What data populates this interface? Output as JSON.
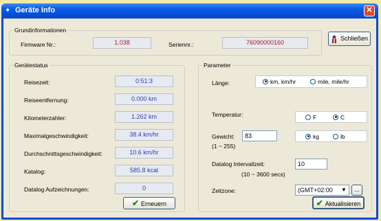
{
  "window": {
    "title": "Geräte Info"
  },
  "basic": {
    "legend": "Grundinformationen",
    "firmware_label": "Firmware Nr.:",
    "firmware_value": "1.038",
    "serial_label": "Seriennr.:",
    "serial_value": "76090000160"
  },
  "close_button": {
    "label": "Schließen",
    "icon": "person-icon"
  },
  "status": {
    "legend": "Gerätestatus",
    "rows": [
      {
        "label": "Reisezeit:",
        "value": "0:51:3"
      },
      {
        "label": "Reiseentfernung:",
        "value": "0.000 km"
      },
      {
        "label": "Kilometerzahler:",
        "value": "1.262 km"
      },
      {
        "label": "Maximalgeschwindigkeit:",
        "value": "38.4 km/hr"
      },
      {
        "label": "Durchschnittsgeschwindigkeit:",
        "value": "10.6 km/hr"
      },
      {
        "label": "Katalog:",
        "value": "585.8 kcal"
      },
      {
        "label": "Datalog Aufzeichnungen:",
        "value": "0"
      }
    ],
    "renew_label": "Erneuern"
  },
  "params": {
    "legend": "Parameter",
    "length_label": "Länge:",
    "length_options": [
      "km, km/hr",
      "mile, mile/hr"
    ],
    "length_selected": "km, km/hr",
    "temp_label": "Temperatur:",
    "temp_options": [
      "F",
      "C"
    ],
    "temp_selected": "C",
    "weight_label": "Gewicht:",
    "weight_range": "(1 ~ 255)",
    "weight_value": "83",
    "weight_units": [
      "kg",
      "lb"
    ],
    "weight_unit_selected": "kg",
    "interval_label": "Datalog Intervallzeit:",
    "interval_range": "(10 ~ 3600 secs)",
    "interval_value": "10",
    "timezone_label": "Zeitzone:",
    "timezone_value": "(GMT+02:00",
    "more_label": "...",
    "update_label": "Aktualisieren"
  },
  "colors": {
    "title_bar": "#0a5ce8",
    "dialog_bg": "#ece9d8",
    "serial_text": "#a51d1d",
    "status_text": "#2c3db4"
  }
}
